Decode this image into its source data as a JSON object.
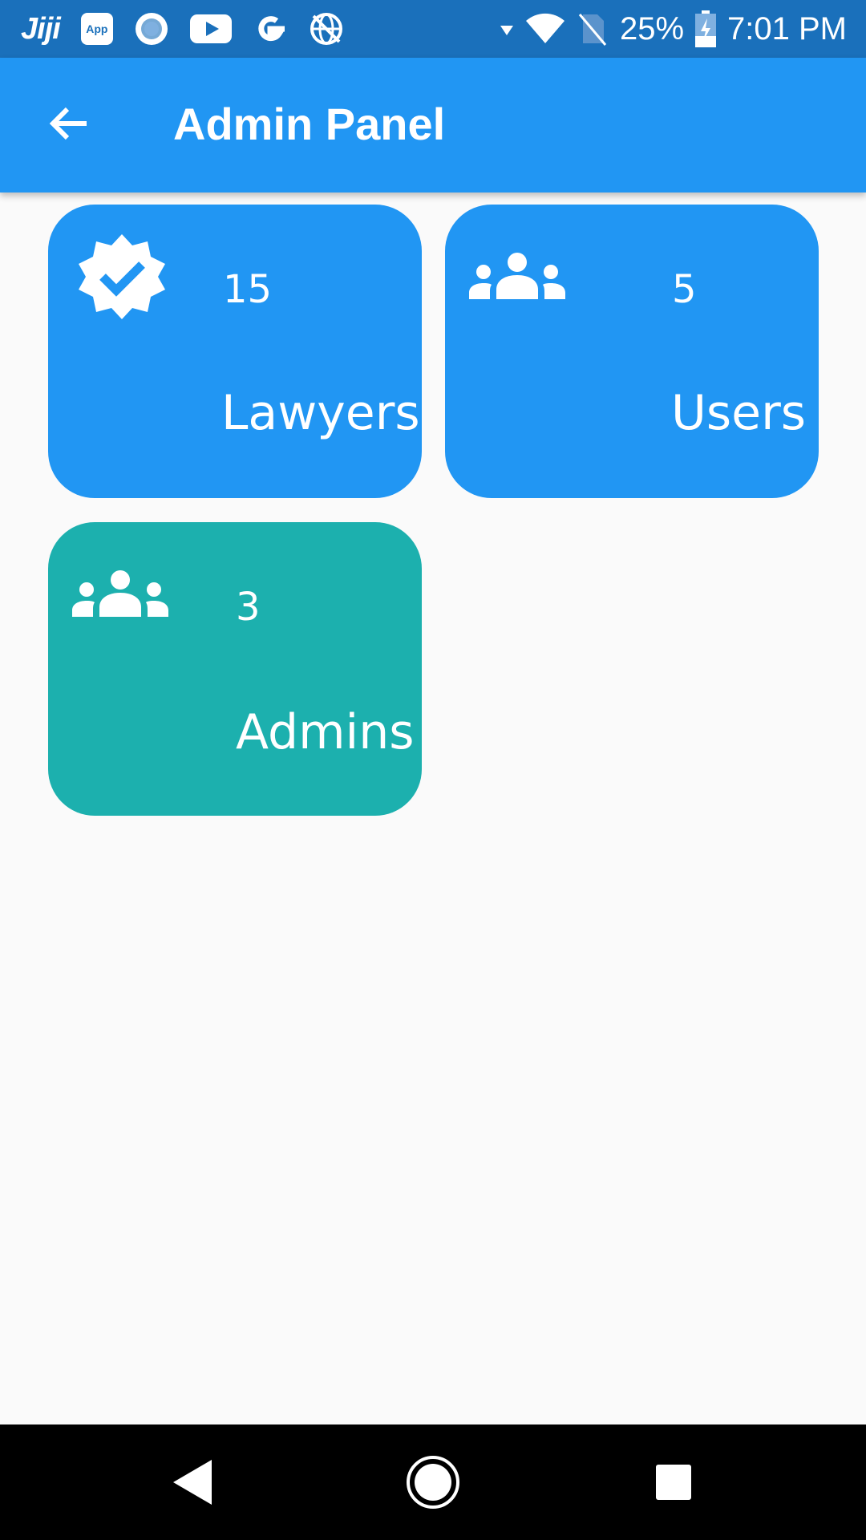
{
  "status_bar": {
    "app_name": "Jiji",
    "app_badge": "App",
    "battery": "25%",
    "time": "7:01 PM",
    "icons": [
      "jiji-icon",
      "app-icon",
      "record-icon",
      "youtube-icon",
      "google-icon",
      "vpn-globe-icon",
      "data-arrows-icon",
      "wifi-icon",
      "no-sim-icon",
      "battery-charging-icon"
    ]
  },
  "app_bar": {
    "title": "Admin Panel",
    "back_icon": "arrow-back-icon",
    "background": "#2196f3"
  },
  "cards": [
    {
      "count": "15",
      "label": "Lawyers",
      "icon": "verified-badge-icon",
      "color": "#2196f3"
    },
    {
      "count": "5",
      "label": "Users",
      "icon": "groups-icon",
      "color": "#2196f3"
    },
    {
      "count": "3",
      "label": "Admins",
      "icon": "groups-icon",
      "color": "#1cb0ae"
    }
  ],
  "nav_bar": {
    "icons": [
      "nav-back-icon",
      "nav-home-icon",
      "nav-recents-icon"
    ]
  }
}
